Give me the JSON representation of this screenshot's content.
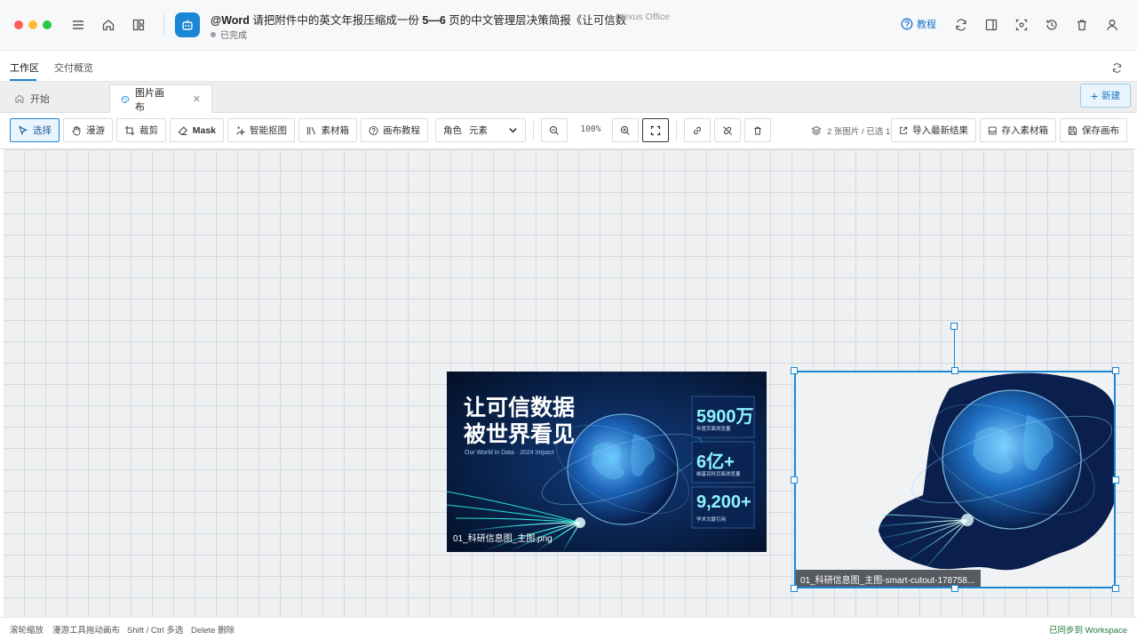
{
  "window": {
    "title_prefix": "@Word",
    "title_text": "请把附件中的英文年报压缩成一份",
    "title_bold": "5—6",
    "title_suffix": "页的中文管理层决策简报《让可信数",
    "app_name": "Nexus Office",
    "status": "已完成",
    "help_label": "教程"
  },
  "workspace_tabs": [
    {
      "label": "工作区",
      "active": true
    },
    {
      "label": "交付概览",
      "active": false
    }
  ],
  "doc_tabs": [
    {
      "label": "开始",
      "icon": "home-icon"
    },
    {
      "label": "图片画布",
      "icon": "palette-icon",
      "active": true
    }
  ],
  "new_label": "新建",
  "toolbar": {
    "select": "选择",
    "pan": "漫游",
    "crop": "裁剪",
    "mask": "Mask",
    "smart_cutout": "智能抠图",
    "library": "素材箱",
    "tutorial": "画布教程",
    "role_label": "角色",
    "role_value": "元素",
    "zoom": "100%",
    "count": "2 张图片 / 已选 1",
    "import_latest": "导入最新结果",
    "save_to_library": "存入素材箱",
    "save_canvas": "保存画布"
  },
  "canvas": {
    "image1": {
      "filename": "01_科研信息图_主图.png",
      "headline_line1": "让可信数据",
      "headline_line2": "被世界看见",
      "tagline": "Our World in Data · 2024 Impact",
      "stats": [
        {
          "value": "5900万",
          "caption": "年度页面浏览量"
        },
        {
          "value": "6亿+",
          "caption": "维基百科页面浏览量"
        },
        {
          "value": "9,200+",
          "caption": "学术文献引用"
        }
      ]
    },
    "image2": {
      "filename": "01_科研信息图_主图-smart-cutout-178758..."
    }
  },
  "statusbar": {
    "hints": [
      "滚轮缩放",
      "漫游工具拖动画布",
      "Shift / Ctrl 多选",
      "Delete 删除"
    ],
    "sync": "已同步到 Workspace"
  }
}
